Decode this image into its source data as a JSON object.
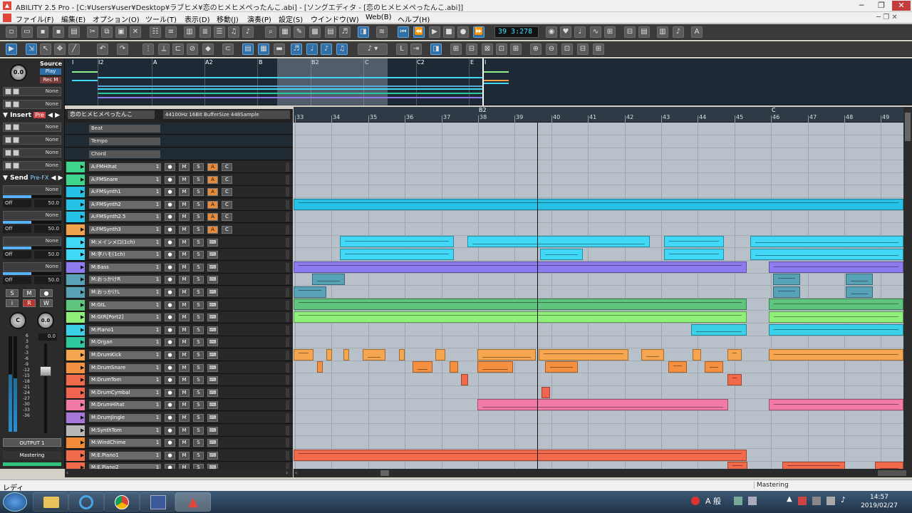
{
  "window": {
    "title": "ABILITY 2.5 Pro - [C:¥Users¥user¥Desktop¥ラブヒメ¥恋のヒメヒメぺったんこ.abi] - [ソングエディタ - [恋のヒメヒメぺったんこ.abi]]",
    "minimize": "─",
    "maximize": "❐",
    "close": "✕"
  },
  "menu": [
    "ファイル(F)",
    "編集(E)",
    "オプション(O)",
    "ツール(T)",
    "表示(D)",
    "移動(J)",
    "演奏(P)",
    "設定(S)",
    "ウインドウ(W)",
    "Web(B)",
    "ヘルプ(H)"
  ],
  "transport": {
    "counter": "39  3:278"
  },
  "inspector": {
    "source_knob": "0.0",
    "source_label": "Source",
    "play": "Play",
    "rec": "Rec M",
    "none": "None",
    "insert_label": "Insert",
    "insert_pre": "Pre",
    "send_label": "Send",
    "send_prefx": "Pre-FX",
    "off": "Off",
    "send_level": "50.0",
    "smw": [
      "S",
      "M",
      "●"
    ],
    "irw": [
      "i",
      "R",
      "W"
    ],
    "pan_knob": "C",
    "vol_knob": "0.0",
    "meter_value": "0.0",
    "meter_scale": [
      "6",
      "3",
      "0",
      "-3",
      "-6",
      "-9",
      "-12",
      "-15",
      "-18",
      "-21",
      "-24",
      "-27",
      "-30",
      "-33",
      "-36"
    ],
    "output": "OUTPUT 1",
    "mastering": "Mastering"
  },
  "overview": {
    "markers": [
      "I",
      "I2",
      "A",
      "A2",
      "B",
      "B2",
      "C",
      "C2",
      "E",
      "I"
    ]
  },
  "song": {
    "name": "恋のヒメヒメぺったんこ",
    "audio_info": "44100Hz 16Bit BufferSize 448Sample"
  },
  "global_tracks": [
    "Beat",
    "Tempo",
    "Chord"
  ],
  "tracks": [
    {
      "name": "A:FMHihat",
      "ch": "1",
      "color": "#3dd58c",
      "audio": true
    },
    {
      "name": "A:FMSnare",
      "ch": "1",
      "color": "#3dd58c",
      "audio": true
    },
    {
      "name": "A:FMSynth1",
      "ch": "1",
      "color": "#26c2e6",
      "audio": true
    },
    {
      "name": "A:FMSynth2",
      "ch": "1",
      "color": "#26c2e6",
      "audio": true
    },
    {
      "name": "A:FMSynth2.5",
      "ch": "1",
      "color": "#26c2e6",
      "audio": true
    },
    {
      "name": "A:FMSynth3",
      "ch": "1",
      "color": "#f0a24a",
      "audio": true
    },
    {
      "name": "M:メインメロ(1ch)",
      "ch": "1",
      "color": "#40d8f6",
      "audio": false
    },
    {
      "name": "M:字ハモ(1ch)",
      "ch": "1",
      "color": "#40d8f6",
      "audio": false
    },
    {
      "name": "M:Bass",
      "ch": "1",
      "color": "#8c7cf0",
      "audio": false
    },
    {
      "name": "M:おっかけR",
      "ch": "1",
      "color": "#58a2b8",
      "audio": false
    },
    {
      "name": "M:おっかけL",
      "ch": "1",
      "color": "#58a2b8",
      "audio": false
    },
    {
      "name": "M:GtL",
      "ch": "1",
      "color": "#5fc47e",
      "audio": false
    },
    {
      "name": "M:GtR[Port2]",
      "ch": "1",
      "color": "#90ee7a",
      "audio": false
    },
    {
      "name": "M:Piano1",
      "ch": "1",
      "color": "#3ad0e8",
      "audio": false
    },
    {
      "name": "M:Organ",
      "ch": "1",
      "color": "#2ec89e",
      "audio": false
    },
    {
      "name": "M:DrumKick",
      "ch": "1",
      "color": "#f6a64e",
      "audio": false
    },
    {
      "name": "M:DrumSnare",
      "ch": "1",
      "color": "#f49040",
      "audio": false
    },
    {
      "name": "M:DrumTom",
      "ch": "1",
      "color": "#f06a4a",
      "audio": false
    },
    {
      "name": "M:DrumCymbal",
      "ch": "1",
      "color": "#f06450",
      "audio": false
    },
    {
      "name": "M:DrumHihat",
      "ch": "1",
      "color": "#f27aa6",
      "audio": false
    },
    {
      "name": "M:DrumJingle",
      "ch": "1",
      "color": "#a676d8",
      "audio": false
    },
    {
      "name": "M:SynthTom",
      "ch": "1",
      "color": "#b8b8b8",
      "audio": false
    },
    {
      "name": "M:WindChime",
      "ch": "1",
      "color": "#f08a36",
      "audio": false
    },
    {
      "name": "M:E.Piano1",
      "ch": "1",
      "color": "#f26a4c",
      "audio": false
    },
    {
      "name": "M:E.Piano2",
      "ch": "1",
      "color": "#f26a4c",
      "audio": false
    }
  ],
  "track_buttons": {
    "rec": "●",
    "m": "M",
    "s": "S",
    "a": "A",
    "c": "C",
    "midi": "⌨"
  },
  "ruler": {
    "bars": [
      "33",
      "34",
      "35",
      "36",
      "37",
      "38",
      "39",
      "40",
      "41",
      "42",
      "43",
      "44",
      "45",
      "46",
      "47",
      "48",
      "49"
    ],
    "markers": [
      {
        "label": "B2",
        "bar": 38
      },
      {
        "label": "C",
        "bar": 46
      }
    ]
  },
  "status": {
    "left": "レディ",
    "right": "Mastering"
  },
  "clock": {
    "time": "14:57",
    "date": "2019/02/27"
  },
  "tray": {
    "ime": "A 般"
  }
}
